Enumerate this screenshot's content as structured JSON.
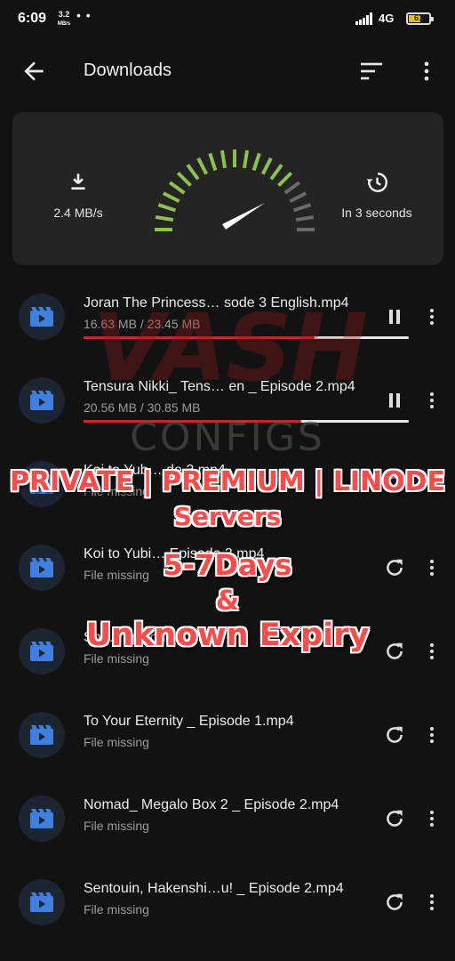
{
  "status_bar": {
    "time": "6:09",
    "net_speed_value": "3.2",
    "net_speed_unit": "MB/s",
    "network": "4G",
    "battery": "61",
    "battery_level_percent": 61
  },
  "app_bar": {
    "title": "Downloads",
    "back_icon": "arrow-left-icon",
    "sort_icon": "sort-icon",
    "more_icon": "more-vertical-icon"
  },
  "speed_card": {
    "speed": "2.4 MB/s",
    "eta": "In 3 seconds",
    "gauge_level_fraction": 0.75,
    "colors": {
      "card": "#242424",
      "gauge_green": "#8bc34a",
      "needle": "#ffffff"
    }
  },
  "downloads": [
    {
      "name": "Joran The Princess…  sode 3 English.mp4",
      "sub": "16.63 MB / 23.45 MB",
      "progress": 0.71,
      "action": "pause",
      "icon": "video-icon"
    },
    {
      "name": "Tensura Nikki_ Tens…  en _ Episode 2.mp4",
      "sub": "20.56 MB / 30.85 MB",
      "progress": 0.67,
      "action": "pause",
      "icon": "video-icon"
    },
    {
      "name": "Koi to Yub…  de 2.mp4",
      "sub": "File missing",
      "progress": null,
      "action": "retry",
      "icon": "video-icon"
    },
    {
      "name": "Koi to Yubi…   Episode 3.mp4",
      "sub": "File missing",
      "progress": null,
      "action": "retry",
      "icon": "video-icon"
    },
    {
      "name": "Shi…   Episode 1.mp4",
      "sub": "File missing",
      "progress": null,
      "action": "retry",
      "icon": "video-icon"
    },
    {
      "name": "To Your Eternity _ Episode 1.mp4",
      "sub": "File missing",
      "progress": null,
      "action": "retry",
      "icon": "video-icon"
    },
    {
      "name": "Nomad_ Megalo Box 2 _ Episode 2.mp4",
      "sub": "File missing",
      "progress": null,
      "action": "retry",
      "icon": "video-icon"
    },
    {
      "name": "Sentouin, Hakenshi…u! _ Episode 2.mp4",
      "sub": "File missing",
      "progress": null,
      "action": "retry",
      "icon": "video-icon"
    }
  ],
  "overlay": {
    "brand_line1": "VASH",
    "brand_line2": "CONFIGS",
    "line1": "PRIVATE | PREMIUM | LINODE",
    "line2": "Servers",
    "line3": "5-7Days",
    "line4": "&",
    "line5": "Unknown Expiry",
    "colors": {
      "text": "#ff4a4a",
      "outline": "#ffffff"
    }
  }
}
